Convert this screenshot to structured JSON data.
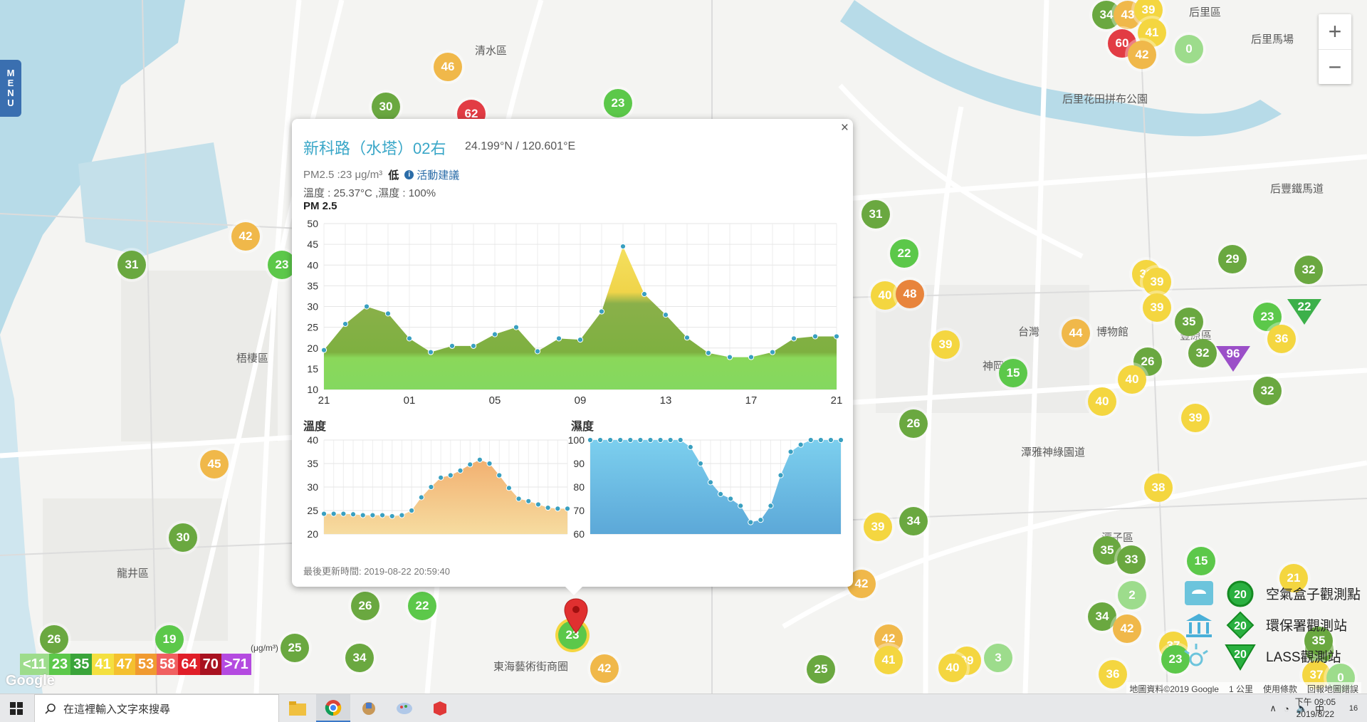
{
  "map": {
    "menu_letters": [
      "M",
      "E",
      "N",
      "U"
    ],
    "place_labels": [
      "清水區",
      "后里區",
      "后里馬場",
      "后里花田拼布公園",
      "后豐鐵馬道",
      "梧棲區",
      "龍井區",
      "台灣",
      "博物館",
      "神岡區",
      "潭雅神綠園道",
      "東海藝術街商圈",
      "潭子區",
      "豐原區"
    ],
    "zoom_in": "+",
    "zoom_out": "−",
    "markers": [
      {
        "v": "34",
        "c": "#6aa840"
      },
      {
        "v": "43",
        "c": "#f0b84a"
      },
      {
        "v": "39",
        "c": "#f4d640"
      },
      {
        "v": "41",
        "c": "#f4d640"
      },
      {
        "v": "60",
        "c": "#e23c44"
      },
      {
        "v": "42",
        "c": "#f0b84a"
      },
      {
        "v": "0",
        "c": "#9ddc8c"
      },
      {
        "v": "46",
        "c": "#f0b84a"
      },
      {
        "v": "30",
        "c": "#6aa840"
      },
      {
        "v": "62",
        "c": "#e23c44"
      },
      {
        "v": "23",
        "c": "#5cc84a"
      },
      {
        "v": "42",
        "c": "#f0b84a"
      },
      {
        "v": "31",
        "c": "#6aa840"
      },
      {
        "v": "23",
        "c": "#5cc84a"
      },
      {
        "v": "45",
        "c": "#f0b84a"
      },
      {
        "v": "30",
        "c": "#6aa840"
      },
      {
        "v": "26",
        "c": "#6aa840"
      },
      {
        "v": "19",
        "c": "#5cc84a"
      },
      {
        "v": "25",
        "c": "#6aa840"
      },
      {
        "v": "34",
        "c": "#6aa840"
      },
      {
        "v": "26",
        "c": "#6aa840"
      },
      {
        "v": "22",
        "c": "#5cc84a"
      },
      {
        "v": "31",
        "c": "#6aa840"
      },
      {
        "v": "22",
        "c": "#5cc84a"
      },
      {
        "v": "40",
        "c": "#f4d640"
      },
      {
        "v": "48",
        "c": "#e8843c"
      },
      {
        "v": "39",
        "c": "#f4d640"
      },
      {
        "v": "15",
        "c": "#5cc84a"
      },
      {
        "v": "26",
        "c": "#6aa840"
      },
      {
        "v": "39",
        "c": "#f4d640"
      },
      {
        "v": "34",
        "c": "#6aa840"
      },
      {
        "v": "42",
        "c": "#f0b84a"
      },
      {
        "v": "42",
        "c": "#f0b84a"
      },
      {
        "v": "41",
        "c": "#f4d640"
      },
      {
        "v": "25",
        "c": "#6aa840"
      },
      {
        "v": "39",
        "c": "#f4d640"
      },
      {
        "v": "39",
        "c": "#f4d640"
      },
      {
        "v": "44",
        "c": "#f0b84a"
      },
      {
        "v": "29",
        "c": "#6aa840"
      },
      {
        "v": "32",
        "c": "#6aa840"
      },
      {
        "v": "39",
        "c": "#f4d640"
      },
      {
        "v": "35",
        "c": "#6aa840"
      },
      {
        "v": "39",
        "c": "#f4d640"
      },
      {
        "v": "26",
        "c": "#6aa840"
      },
      {
        "v": "32",
        "c": "#6aa840"
      },
      {
        "v": "23",
        "c": "#5cc84a"
      },
      {
        "v": "36",
        "c": "#f4d640"
      },
      {
        "v": "40",
        "c": "#f4d640"
      },
      {
        "v": "40",
        "c": "#f4d640"
      },
      {
        "v": "32",
        "c": "#6aa840"
      },
      {
        "v": "39",
        "c": "#f4d640"
      },
      {
        "v": "38",
        "c": "#f4d640"
      },
      {
        "v": "35",
        "c": "#6aa840"
      },
      {
        "v": "33",
        "c": "#6aa840"
      },
      {
        "v": "15",
        "c": "#5cc84a"
      },
      {
        "v": "2",
        "c": "#9ddc8c"
      },
      {
        "v": "34",
        "c": "#6aa840"
      },
      {
        "v": "42",
        "c": "#f0b84a"
      },
      {
        "v": "37",
        "c": "#f4d640"
      },
      {
        "v": "33",
        "c": "#6aa840"
      },
      {
        "v": "3",
        "c": "#9ddc8c"
      },
      {
        "v": "40",
        "c": "#f4d640"
      },
      {
        "v": "36",
        "c": "#f4d640"
      },
      {
        "v": "37",
        "c": "#f4d640"
      },
      {
        "v": "0",
        "c": "#9ddc8c"
      },
      {
        "v": "35",
        "c": "#6aa840"
      },
      {
        "v": "21",
        "c": "#f4d640"
      },
      {
        "v": "23",
        "c": "#5cc84a"
      },
      {
        "v": "42",
        "c": "#f0b84a"
      }
    ],
    "triangle_markers": [
      {
        "v": "22",
        "c": "#3cb04a"
      },
      {
        "v": "96",
        "c": "#9b4fc8"
      }
    ],
    "selected_marker": "23"
  },
  "popup": {
    "close": "×",
    "title": "新科路（水塔）02右",
    "coords": "24.199°N / 120.601°E",
    "pm_text": "PM2.5 :23 μg/m³",
    "pm_level": "低",
    "advice_icon": "i",
    "advice": "活動建議",
    "weather": "溫度 : 25.37°C ,濕度 : 100%",
    "pm_chart_title": "PM 2.5",
    "temp_chart_title": "溫度",
    "hum_chart_title": "濕度",
    "updated": "最後更新時間: 2019-08-22 20:59:40"
  },
  "chart_data": [
    {
      "type": "area",
      "title": "PM 2.5",
      "x": [
        "21",
        "22",
        "23",
        "00",
        "01",
        "02",
        "03",
        "04",
        "05",
        "06",
        "07",
        "08",
        "09",
        "10",
        "11",
        "12",
        "13",
        "14",
        "15",
        "16",
        "17",
        "18",
        "19",
        "20",
        "21"
      ],
      "x_tick_labels": [
        "21",
        "01",
        "05",
        "09",
        "13",
        "17",
        "21"
      ],
      "values": [
        19.5,
        25.8,
        30,
        28.3,
        22.3,
        19,
        20.5,
        20.5,
        23.3,
        25,
        19.2,
        22.3,
        22,
        28.8,
        44.5,
        33,
        28,
        22.5,
        18.8,
        17.8,
        17.8,
        19,
        22.3,
        22.8,
        22.8
      ],
      "ylim": [
        10,
        50
      ],
      "y_ticks": [
        10,
        15,
        20,
        25,
        30,
        35,
        40,
        45,
        50
      ],
      "grid": true
    },
    {
      "type": "area",
      "title": "溫度",
      "values": [
        24.3,
        24.3,
        24.3,
        24.2,
        24,
        24,
        24,
        23.8,
        24,
        25,
        27.8,
        30,
        32,
        32.5,
        33.5,
        34.8,
        35.8,
        35,
        32.5,
        29.8,
        27.5,
        27,
        26.3,
        25.6,
        25.4,
        25.4
      ],
      "ylim": [
        20,
        40
      ],
      "y_ticks": [
        20,
        25,
        30,
        35,
        40
      ],
      "grid": true
    },
    {
      "type": "area",
      "title": "濕度",
      "values": [
        100,
        100,
        100,
        100,
        100,
        100,
        100,
        100,
        100,
        100,
        97,
        90,
        82,
        77,
        75,
        72,
        65,
        66,
        72,
        85,
        95,
        98,
        100,
        100,
        100,
        100
      ],
      "ylim": [
        60,
        100
      ],
      "y_ticks": [
        60,
        70,
        80,
        90,
        100
      ],
      "grid": true
    }
  ],
  "aqi_legend": {
    "unit": "(μg/m³)",
    "items": [
      {
        "label": "<11",
        "c": "#9ddc8c"
      },
      {
        "label": "23",
        "c": "#5cc84a"
      },
      {
        "label": "35",
        "c": "#3aa43a"
      },
      {
        "label": "41",
        "c": "#f4e040"
      },
      {
        "label": "47",
        "c": "#f4c030"
      },
      {
        "label": "53",
        "c": "#f09a30"
      },
      {
        "label": "58",
        "c": "#f06060"
      },
      {
        "label": "64",
        "c": "#e01e28"
      },
      {
        "label": "70",
        "c": "#a81220"
      },
      {
        "label": ">71",
        "c": "#b44ae0"
      }
    ]
  },
  "type_legend": {
    "value": "20",
    "items": [
      "空氣盒子觀測點",
      "環保署觀測站",
      "LASS觀測站"
    ]
  },
  "footer": {
    "google": "Google",
    "map_data": "地圖資料©2019 Google",
    "scale": "1 公里",
    "terms": "使用條款",
    "report": "回報地圖錯誤"
  },
  "taskbar": {
    "search_placeholder": "在這裡輸入文字來搜尋",
    "time": "下午 09:05",
    "date": "2019/8/22",
    "ime": "中",
    "notifications": "16"
  }
}
